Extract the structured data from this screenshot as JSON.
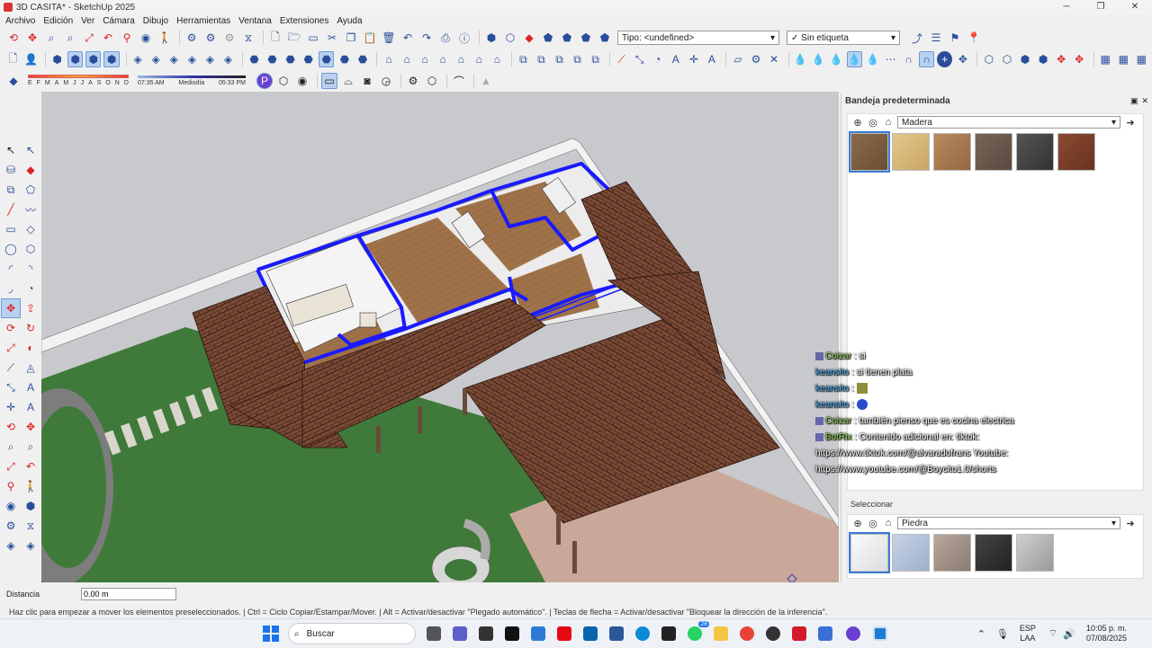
{
  "window": {
    "title": "3D CASITA* - SketchUp 2025"
  },
  "menu": [
    "Archivo",
    "Edición",
    "Ver",
    "Cámara",
    "Dibujo",
    "Herramientas",
    "Ventana",
    "Extensiones",
    "Ayuda"
  ],
  "toolbar": {
    "type_dropdown": "Tipo: <undefined>",
    "tag_dropdown": "Sin etiqueta",
    "shadow_months": [
      "E",
      "F",
      "M",
      "A",
      "M",
      "J",
      "J",
      "A",
      "S",
      "O",
      "N",
      "D"
    ],
    "shadow_time_start": "07:35 AM",
    "shadow_time_mid": "Mediodía",
    "shadow_time_end": "05:33 PM"
  },
  "tray": {
    "title": "Bandeja predeterminada",
    "materials_top": {
      "category": "Madera"
    },
    "select_tab": "Seleccionar",
    "materials_bottom": {
      "category": "Piedra"
    }
  },
  "chat": [
    {
      "nick": "Coizar",
      "text": ": si"
    },
    {
      "nick": "keansito",
      "text": ": si tienen plata"
    },
    {
      "nick": "keansito",
      "text": ":"
    },
    {
      "nick": "keansito",
      "text": ":"
    },
    {
      "nick": "Coizar",
      "text": ": también pienso que es cocina electrica"
    },
    {
      "nick": "BotRix",
      "text": ": Contenido adicional en: tiktok:"
    }
  ],
  "chat_urls": [
    "https://www.tiktok.com/@alvaradofrans Youtube:",
    "https://www.youtube.com/@Boycito1.0/shorts"
  ],
  "measure": {
    "label": "Distancia",
    "value": "0.00 m"
  },
  "status_text": "Haz clic para empezar a mover los elementos preseleccionados. | Ctrl = Ciclo Copiar/Estampar/Mover. | Alt = Activar/desactivar \"Plegado automático\". | Teclas de flecha = Activar/desactivar \"Bloquear la dirección de la inferencia\".",
  "taskbar": {
    "search_placeholder": "Buscar",
    "language": "ESP",
    "language_sub": "LAA",
    "time": "10:05 p. m.",
    "date": "07/08/2025",
    "whatsapp_badge": "28"
  },
  "colors": {
    "selection": "#1a1aff",
    "roof": "#7a4a35",
    "wood_floor": "#a0724a",
    "grass": "#3f7a3a",
    "paving": "#c9a89a"
  }
}
